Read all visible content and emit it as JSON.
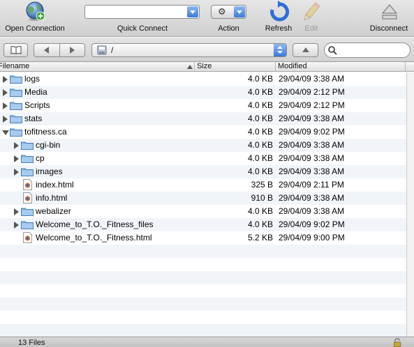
{
  "toolbar": {
    "open_connection": "Open Connection",
    "quick_connect": "Quick Connect",
    "quick_connect_value": "",
    "action": "Action",
    "refresh": "Refresh",
    "edit": "Edit",
    "disconnect": "Disconnect"
  },
  "pathbar": {
    "path": "/",
    "search_value": ""
  },
  "columns": {
    "filename": "Filename",
    "size": "Size",
    "modified": "Modified"
  },
  "files": [
    {
      "name": "logs",
      "type": "folder",
      "depth": 0,
      "state": "closed",
      "size": "4.0 KB",
      "modified": "29/04/09 3:38 AM"
    },
    {
      "name": "Media",
      "type": "folder",
      "depth": 0,
      "state": "closed",
      "size": "4.0 KB",
      "modified": "29/04/09 2:12 PM"
    },
    {
      "name": "Scripts",
      "type": "folder",
      "depth": 0,
      "state": "closed",
      "size": "4.0 KB",
      "modified": "29/04/09 2:12 PM"
    },
    {
      "name": "stats",
      "type": "folder",
      "depth": 0,
      "state": "closed",
      "size": "4.0 KB",
      "modified": "29/04/09 3:38 AM"
    },
    {
      "name": "tofitness.ca",
      "type": "folder",
      "depth": 0,
      "state": "open",
      "size": "4.0 KB",
      "modified": "29/04/09 9:02 PM"
    },
    {
      "name": "cgi-bin",
      "type": "folder",
      "depth": 1,
      "state": "closed",
      "size": "4.0 KB",
      "modified": "29/04/09 3:38 AM"
    },
    {
      "name": "cp",
      "type": "folder",
      "depth": 1,
      "state": "closed",
      "size": "4.0 KB",
      "modified": "29/04/09 3:38 AM"
    },
    {
      "name": "images",
      "type": "folder",
      "depth": 1,
      "state": "closed",
      "size": "4.0 KB",
      "modified": "29/04/09 3:38 AM"
    },
    {
      "name": "index.html",
      "type": "file",
      "depth": 1,
      "state": "none",
      "size": "325 B",
      "modified": "29/04/09 2:11 PM"
    },
    {
      "name": "info.html",
      "type": "file",
      "depth": 1,
      "state": "none",
      "size": "910 B",
      "modified": "29/04/09 3:38 AM"
    },
    {
      "name": "webalizer",
      "type": "folder",
      "depth": 1,
      "state": "closed",
      "size": "4.0 KB",
      "modified": "29/04/09 3:38 AM"
    },
    {
      "name": "Welcome_to_T.O._Fitness_files",
      "type": "folder",
      "depth": 1,
      "state": "closed",
      "size": "4.0 KB",
      "modified": "29/04/09 9:02 PM"
    },
    {
      "name": "Welcome_to_T.O._Fitness.html",
      "type": "file",
      "depth": 1,
      "state": "none",
      "size": "5.2 KB",
      "modified": "29/04/09 9:00 PM"
    }
  ],
  "status": {
    "text": "13 Files"
  },
  "colors": {
    "folder": "#86b3e3",
    "accent": "#3a7ad8",
    "row_alt": "#f1f5fa"
  }
}
